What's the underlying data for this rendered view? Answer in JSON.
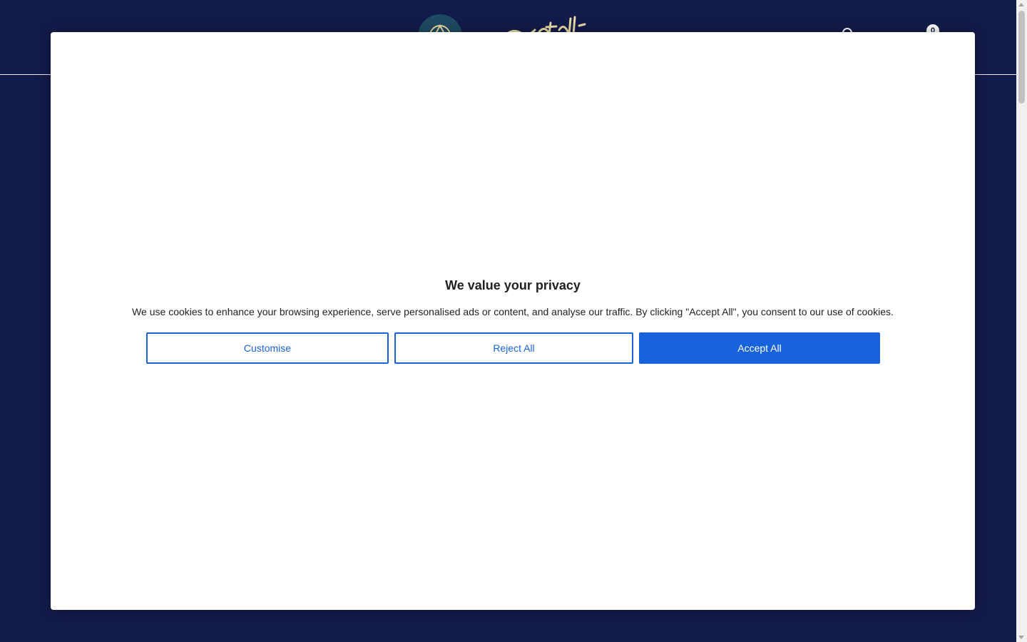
{
  "header": {
    "cart_count": "0"
  },
  "consent": {
    "title": "We value your privacy",
    "message": "We use cookies to enhance your browsing experience, serve personalised ads or content, and analyse our traffic. By clicking \"Accept All\", you consent to our use of cookies.",
    "customise_label": "Customise",
    "reject_label": "Reject All",
    "accept_label": "Accept All"
  },
  "colors": {
    "page_background": "#131b4a",
    "accent": "#1863dc",
    "modal_background": "#ffffff",
    "text": "#212121"
  },
  "icons": {
    "search": "search-icon",
    "cart": "cart-icon",
    "logo": "logo-emblem-icon"
  }
}
